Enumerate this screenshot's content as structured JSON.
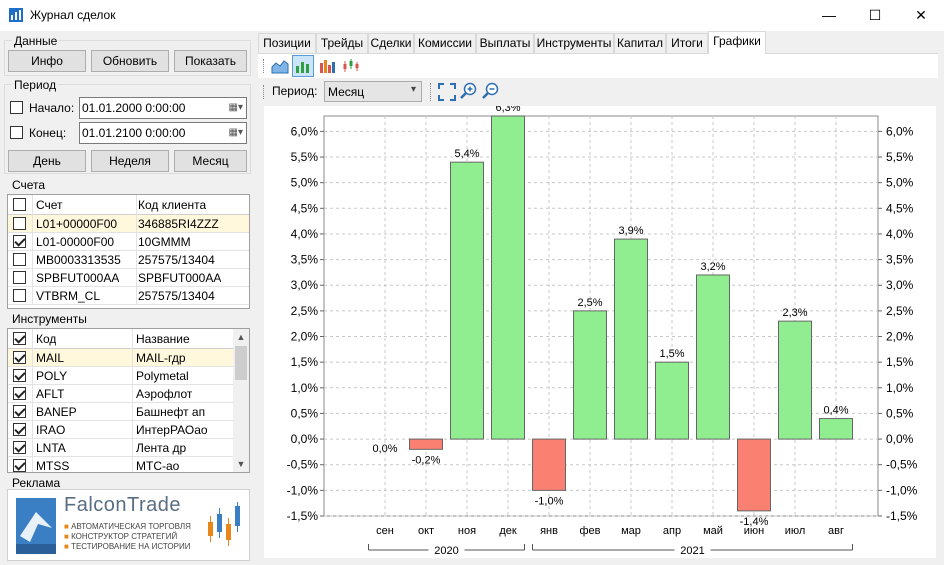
{
  "window": {
    "title": "Журнал сделок",
    "min_glyph": "—",
    "max_glyph": "☐",
    "close_glyph": "✕"
  },
  "data_group": {
    "label": "Данные",
    "buttons": [
      "Инфо",
      "Обновить",
      "Показать"
    ]
  },
  "period_group": {
    "label": "Период",
    "start_label": "Начало:",
    "start_value": "01.01.2000  0:00:00",
    "end_label": "Конец:",
    "end_value": "01.01.2100  0:00:00",
    "buttons": [
      "День",
      "Неделя",
      "Месяц"
    ]
  },
  "accounts": {
    "label": "Счета",
    "headers": [
      "Счет",
      "Код клиента"
    ],
    "rows": [
      {
        "checked": false,
        "account": "L01+00000F00",
        "client": "346885RI4ZZZ",
        "highlight": true
      },
      {
        "checked": true,
        "account": "L01-00000F00",
        "client": "10GMMM",
        "highlight": false
      },
      {
        "checked": false,
        "account": "MB0003313535",
        "client": "257575/13404",
        "highlight": false
      },
      {
        "checked": false,
        "account": "SPBFUT000AA",
        "client": "SPBFUT000AA",
        "highlight": false
      },
      {
        "checked": false,
        "account": "VTBRM_CL",
        "client": "257575/13404",
        "highlight": false
      }
    ]
  },
  "instruments": {
    "label": "Инструменты",
    "headers": [
      "Код",
      "Название"
    ],
    "rows": [
      {
        "checked": true,
        "code": "MAIL",
        "name": "MAIL-гдр",
        "highlight": true
      },
      {
        "checked": true,
        "code": "POLY",
        "name": "Polymetal",
        "highlight": false
      },
      {
        "checked": true,
        "code": "AFLT",
        "name": "Аэрофлот",
        "highlight": false
      },
      {
        "checked": true,
        "code": "BANEP",
        "name": "Башнефт ап",
        "highlight": false
      },
      {
        "checked": true,
        "code": "IRAO",
        "name": "ИнтерРАОао",
        "highlight": false
      },
      {
        "checked": true,
        "code": "LNTA",
        "name": "Лента др",
        "highlight": false
      },
      {
        "checked": true,
        "code": "MTSS",
        "name": "МТС-ао",
        "highlight": false
      }
    ]
  },
  "ad": {
    "label": "Реклама",
    "brand": "FalconTrade",
    "lines": [
      "АВТОМАТИЧЕСКАЯ ТОРГОВЛЯ",
      "КОНСТРУКТОР СТРАТЕГИЙ",
      "ТЕСТИРОВАНИЕ НА ИСТОРИИ"
    ]
  },
  "tabs": [
    "Позиции",
    "Трейды",
    "Сделки",
    "Комиссии",
    "Выплаты",
    "Инструменты",
    "Капитал",
    "Итоги",
    "Графики"
  ],
  "active_tab": 8,
  "toolbar2": {
    "period_label": "Период:",
    "period_value": "Месяц"
  },
  "colors": {
    "positive": "#90ee90",
    "negative": "#fa8072",
    "highlight_row": "#fff8dc"
  },
  "chart_data": {
    "type": "bar",
    "categories": [
      "сен",
      "окт",
      "ноя",
      "дек",
      "янв",
      "фев",
      "мар",
      "апр",
      "май",
      "июн",
      "июл",
      "авг"
    ],
    "values": [
      0.0,
      -0.2,
      5.4,
      6.3,
      -1.0,
      2.5,
      3.9,
      1.5,
      3.2,
      -1.4,
      2.3,
      0.4
    ],
    "value_labels": [
      "0,0%",
      "-0,2%",
      "5,4%",
      "6,3%",
      "-1,0%",
      "2,5%",
      "3,9%",
      "1,5%",
      "3,2%",
      "-1,4%",
      "2,3%",
      "0,4%"
    ],
    "year_groups": [
      {
        "label": "2020",
        "months": 4
      },
      {
        "label": "2021",
        "months": 8
      }
    ],
    "ylim": [
      -1.5,
      6.3
    ],
    "yticks": [
      6.0,
      5.5,
      5.0,
      4.5,
      4.0,
      3.5,
      3.0,
      2.5,
      2.0,
      1.5,
      1.0,
      0.5,
      0.0,
      -0.5,
      -1.0,
      -1.5
    ],
    "ytick_labels": [
      "6,0%",
      "5,5%",
      "5,0%",
      "4,5%",
      "4,0%",
      "3,5%",
      "3,0%",
      "2,5%",
      "2,0%",
      "1,5%",
      "1,0%",
      "0,5%",
      "0,0%",
      "-0,5%",
      "-1,0%",
      "-1,5%"
    ],
    "grid": true,
    "axes": "left-and-right"
  }
}
